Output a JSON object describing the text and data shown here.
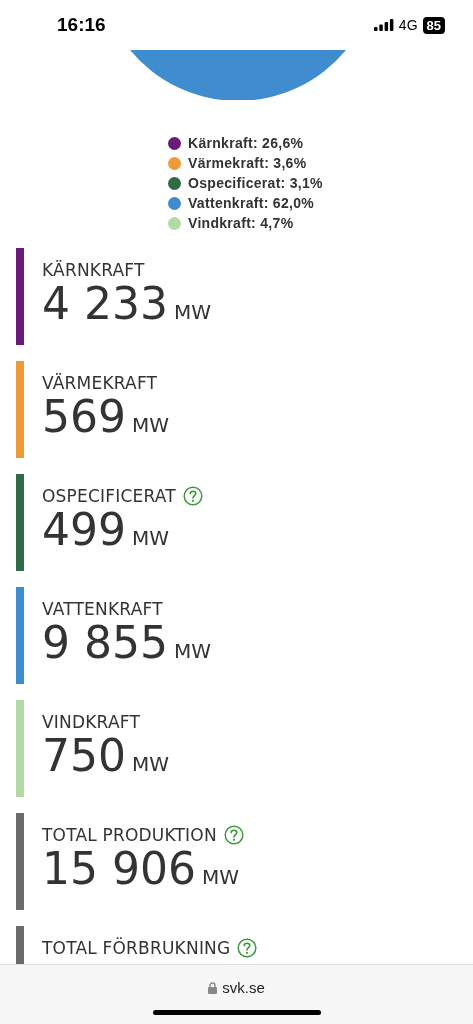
{
  "status_bar": {
    "time": "16:16",
    "network": "4G",
    "battery": "85"
  },
  "legend": [
    {
      "label": "Kärnkraft: 26,6%",
      "color": "#6a1b78"
    },
    {
      "label": "Värmekraft: 3,6%",
      "color": "#ee9a3a"
    },
    {
      "label": "Ospecificerat: 3,1%",
      "color": "#2e6b46"
    },
    {
      "label": "Vattenkraft: 62,0%",
      "color": "#3f8ccf"
    },
    {
      "label": "Vindkraft: 4,7%",
      "color": "#b3d9a6"
    }
  ],
  "cards": [
    {
      "label": "KÄRNKRAFT",
      "value": "4 233",
      "unit": "MW",
      "color": "#6a1b78",
      "help": false
    },
    {
      "label": "VÄRMEKRAFT",
      "value": "569",
      "unit": "MW",
      "color": "#ee9a3a",
      "help": false
    },
    {
      "label": "OSPECIFICERAT",
      "value": "499",
      "unit": "MW",
      "color": "#2e6b46",
      "help": true
    },
    {
      "label": "VATTENKRAFT",
      "value": "9 855",
      "unit": "MW",
      "color": "#3f8ccf",
      "help": false
    },
    {
      "label": "VINDKRAFT",
      "value": "750",
      "unit": "MW",
      "color": "#b3d9a6",
      "help": false
    },
    {
      "label": "TOTAL PRODUKTION",
      "value": "15 906",
      "unit": "MW",
      "color": "#6b6b6b",
      "help": true
    },
    {
      "label": "TOTAL FÖRBRUKNING",
      "color": "#6b6b6b",
      "help": true
    }
  ],
  "address_bar": {
    "url": "svk.se"
  }
}
